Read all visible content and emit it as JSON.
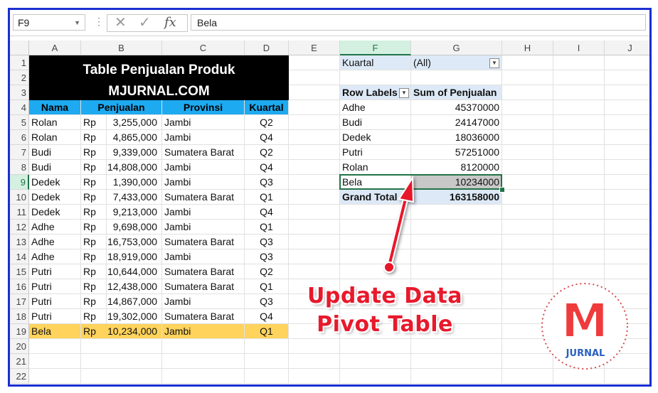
{
  "formula_bar": {
    "name_box": "F9",
    "fx_label": "fx",
    "formula": "Bela"
  },
  "columns": [
    "A",
    "B",
    "C",
    "D",
    "E",
    "F",
    "G",
    "H",
    "I",
    "J"
  ],
  "rows": [
    "1",
    "2",
    "3",
    "4",
    "5",
    "6",
    "7",
    "8",
    "9",
    "10",
    "11",
    "12",
    "13",
    "14",
    "15",
    "16",
    "17",
    "18",
    "19",
    "20",
    "21",
    "22"
  ],
  "table": {
    "title_line1": "Table Penjualan Produk",
    "title_line2": "MJURNAL.COM",
    "headers": [
      "Nama",
      "Penjualan",
      "Provinsi",
      "Kuartal"
    ],
    "currency": "Rp",
    "rows": [
      {
        "nama": "Rolan",
        "penjualan": "3,255,000",
        "provinsi": "Jambi",
        "kuartal": "Q2"
      },
      {
        "nama": "Rolan",
        "penjualan": "4,865,000",
        "provinsi": "Jambi",
        "kuartal": "Q4"
      },
      {
        "nama": "Budi",
        "penjualan": "9,339,000",
        "provinsi": "Sumatera Barat",
        "kuartal": "Q2"
      },
      {
        "nama": "Budi",
        "penjualan": "14,808,000",
        "provinsi": "Jambi",
        "kuartal": "Q4"
      },
      {
        "nama": "Dedek",
        "penjualan": "1,390,000",
        "provinsi": "Jambi",
        "kuartal": "Q3"
      },
      {
        "nama": "Dedek",
        "penjualan": "7,433,000",
        "provinsi": "Sumatera Barat",
        "kuartal": "Q1"
      },
      {
        "nama": "Dedek",
        "penjualan": "9,213,000",
        "provinsi": "Jambi",
        "kuartal": "Q4"
      },
      {
        "nama": "Adhe",
        "penjualan": "9,698,000",
        "provinsi": "Jambi",
        "kuartal": "Q1"
      },
      {
        "nama": "Adhe",
        "penjualan": "16,753,000",
        "provinsi": "Sumatera Barat",
        "kuartal": "Q3"
      },
      {
        "nama": "Adhe",
        "penjualan": "18,919,000",
        "provinsi": "Jambi",
        "kuartal": "Q3"
      },
      {
        "nama": "Putri",
        "penjualan": "10,644,000",
        "provinsi": "Sumatera Barat",
        "kuartal": "Q2"
      },
      {
        "nama": "Putri",
        "penjualan": "12,438,000",
        "provinsi": "Sumatera Barat",
        "kuartal": "Q1"
      },
      {
        "nama": "Putri",
        "penjualan": "14,867,000",
        "provinsi": "Jambi",
        "kuartal": "Q3"
      },
      {
        "nama": "Putri",
        "penjualan": "19,302,000",
        "provinsi": "Sumatera Barat",
        "kuartal": "Q4"
      },
      {
        "nama": "Bela",
        "penjualan": "10,234,000",
        "provinsi": "Jambi",
        "kuartal": "Q1"
      }
    ]
  },
  "pivot": {
    "filter_label": "Kuartal",
    "filter_value": "(All)",
    "row_labels_header": "Row Labels",
    "values_header": "Sum of Penjualan",
    "rows": [
      {
        "label": "Adhe",
        "value": "45370000"
      },
      {
        "label": "Budi",
        "value": "24147000"
      },
      {
        "label": "Dedek",
        "value": "18036000"
      },
      {
        "label": "Putri",
        "value": "57251000"
      },
      {
        "label": "Rolan",
        "value": "8120000"
      },
      {
        "label": "Bela",
        "value": "10234000"
      }
    ],
    "grand_total_label": "Grand Total",
    "grand_total_value": "163158000"
  },
  "annotation": {
    "line1": "Update Data",
    "line2": "Pivot Table"
  },
  "logo": {
    "letter": "M",
    "word": "JURNAL"
  },
  "colors": {
    "title_bg": "#000000",
    "header_bg": "#1eaaf0",
    "highlight_row": "#ffd35c",
    "pivot_bg": "#dde9f6",
    "annotation": "#e8192c",
    "frame": "#1a2fd1",
    "excel_green": "#217346"
  }
}
